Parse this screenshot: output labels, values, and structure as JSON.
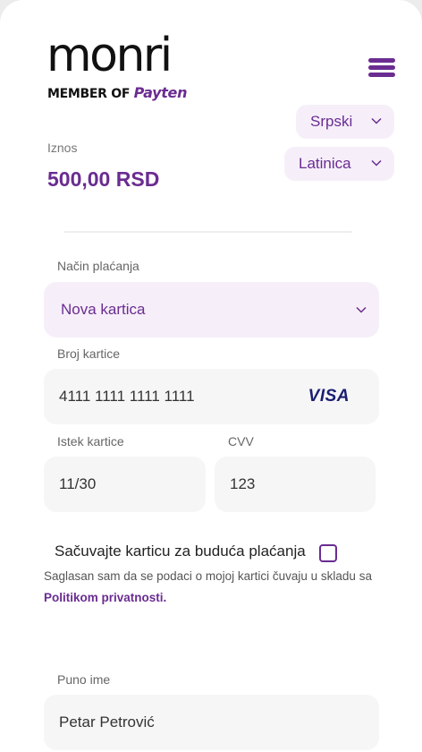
{
  "brand": {
    "name": "monri",
    "tagline_prefix": "MEMBER OF",
    "tagline_brand": "Payten"
  },
  "language": {
    "selected": "Srpski"
  },
  "script": {
    "selected": "Latinica"
  },
  "amount": {
    "label": "Iznos",
    "value": "500,00 RSD"
  },
  "payment": {
    "method_label": "Način plaćanja",
    "method_value": "Nova kartica",
    "card_number_label": "Broj kartice",
    "card_number_value": "4111 1111 1111 1111",
    "card_brand": "VISA",
    "expiry_label": "Istek kartice",
    "expiry_value": "11/30",
    "cvv_label": "CVV",
    "cvv_value": "123",
    "save_card_label": "Sačuvajte karticu za buduća plaćanja",
    "save_card_checked": false,
    "consent_text": "Saglasan sam da se podaci o mojoj kartici čuvaju u skladu sa",
    "consent_link": "Politikom privatnosti."
  },
  "billing": {
    "full_name_label": "Puno ime",
    "full_name_value": "Petar Petrović"
  },
  "colors": {
    "accent": "#6a2c91",
    "accent_bg": "#f6eff9",
    "field_bg": "#f6f6f6",
    "visa": "#1a1f71"
  }
}
